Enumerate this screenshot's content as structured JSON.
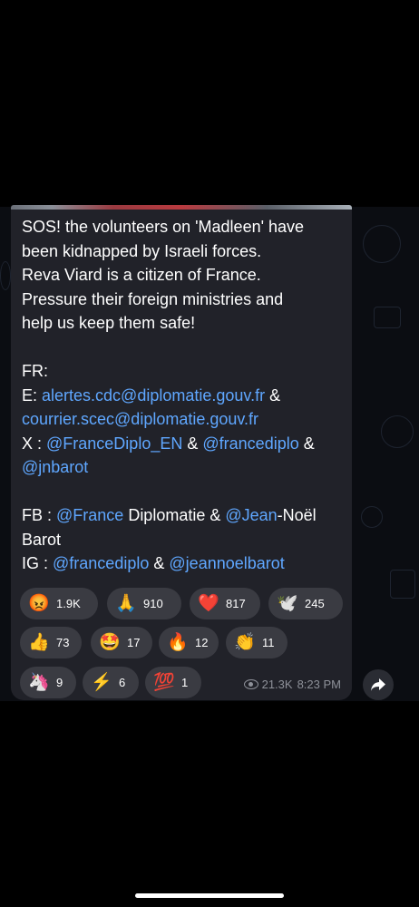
{
  "message": {
    "intro_lines": [
      "SOS! the volunteers on 'Madleen' have",
      "been kidnapped by Israeli forces.",
      "Reva Viard is a citizen of France.",
      "Pressure their foreign ministries and",
      "help us keep them safe!"
    ],
    "fr_label": "FR:",
    "email_prefix": "E: ",
    "email_1": "alertes.cdc@diplomatie.gouv.fr",
    "amp": "&",
    "email_2": "courrier.scec@diplomatie.gouv.fr",
    "x_prefix": "X : ",
    "x_handle_1": "@FranceDiplo_EN",
    "x_handle_2": "@francediplo",
    "x_handle_3": "@jnbarot",
    "fb_prefix": "FB : ",
    "fb_link_1": "@France",
    "fb_text_1": " Diplomatie & ",
    "fb_link_2": "@Jean",
    "fb_text_2": "-Noël",
    "fb_line_2": "Barot",
    "ig_prefix": "IG : ",
    "ig_handle_1": "@francediplo",
    "ig_handle_2": "@jeannoelbarot"
  },
  "reactions": [
    {
      "emoji": "😡",
      "count": "1.9K"
    },
    {
      "emoji": "🙏",
      "count": "910"
    },
    {
      "emoji": "❤️",
      "count": "817"
    },
    {
      "emoji": "🕊️",
      "count": "245"
    },
    {
      "emoji": "👍",
      "count": "73"
    },
    {
      "emoji": "🤩",
      "count": "17"
    },
    {
      "emoji": "🔥",
      "count": "12"
    },
    {
      "emoji": "👏",
      "count": "11"
    },
    {
      "emoji": "🦄",
      "count": "9"
    },
    {
      "emoji": "⚡",
      "count": "6"
    },
    {
      "emoji": "💯",
      "count": "1"
    }
  ],
  "meta": {
    "views": "21.3K",
    "time": "8:23 PM",
    "view_icon": "eye-icon"
  },
  "share_icon": "share-arrow-icon",
  "colors": {
    "bubble": "#212229",
    "link": "#5fa7ff",
    "chip": "#3a3b42",
    "background": "#0b0d12"
  }
}
